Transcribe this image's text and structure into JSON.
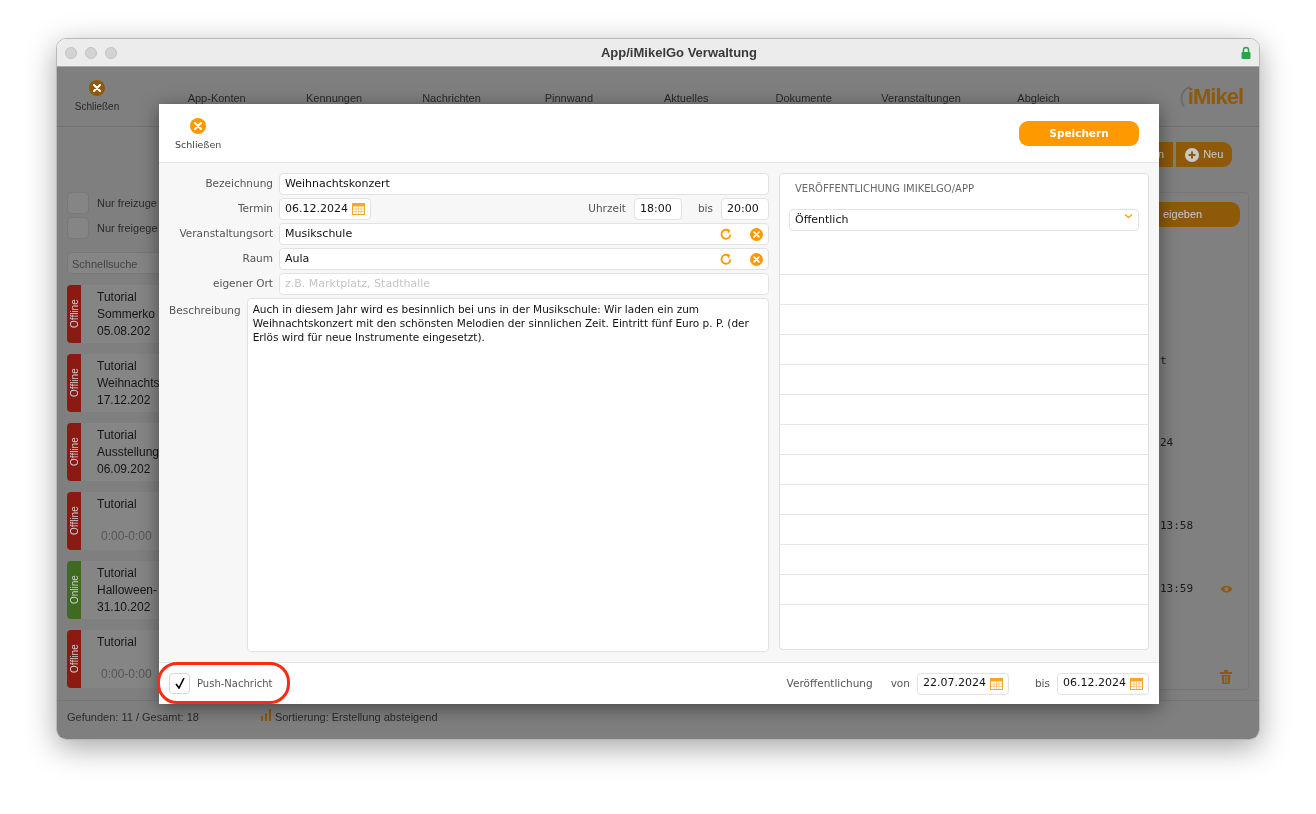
{
  "window": {
    "title": "App/iMikelGo Verwaltung"
  },
  "toolbar": {
    "close_label": "Schließen",
    "nav": [
      {
        "label": "App-Konten"
      },
      {
        "label": "Kennungen"
      },
      {
        "label": "Nachrichten"
      },
      {
        "label": "Pinnwand"
      },
      {
        "label": "Aktuelles"
      },
      {
        "label": "Dokumente"
      },
      {
        "label": "Veranstaltungen"
      },
      {
        "label": "Abgleich"
      }
    ],
    "logo": "iMikel"
  },
  "sidebar": {
    "filters": [
      {
        "label": "Nur freizuge",
        "checked": false
      },
      {
        "label": "Nur freigege",
        "checked": false
      }
    ],
    "search": {
      "placeholder": "Schnellsuche"
    },
    "items": [
      {
        "status": "Offline",
        "online": false,
        "title": "Tutorial",
        "subtitle": "Sommerko",
        "date": "05.08.202"
      },
      {
        "status": "Offline",
        "online": false,
        "title": "Tutorial",
        "subtitle": "Weihnachts",
        "date": "17.12.202"
      },
      {
        "status": "Offline",
        "online": false,
        "title": "Tutorial",
        "subtitle": "Ausstellung",
        "date": "06.09.202"
      },
      {
        "status": "Offline",
        "online": false,
        "title": "Tutorial",
        "time": "0:00-0:00"
      },
      {
        "status": "Online",
        "online": true,
        "title": "Tutorial",
        "subtitle": "Halloween-",
        "date": "31.10.202"
      },
      {
        "status": "Offline",
        "online": false,
        "title": "Tutorial",
        "time": "0:00-0:00"
      }
    ]
  },
  "right_panel": {
    "buttons": [
      {
        "label": "n",
        "kind": "plain"
      },
      {
        "label": "Neu",
        "kind": "add"
      }
    ],
    "release_button": "eigeben",
    "details": [
      {
        "text": "t"
      },
      {
        "text": "24"
      },
      {
        "text": "13:58"
      },
      {
        "text": "13:59",
        "visible_icon": true
      }
    ]
  },
  "status_bar": {
    "found": "Gefunden: 11 / Gesamt: 18",
    "sorting": "Sortierung: Erstellung absteigend"
  },
  "dialog": {
    "close_label": "Schließen",
    "save_label": "Speichern",
    "fields": [
      {
        "kind": "text",
        "label": "Bezeichnung",
        "value": "Weihnachtskonzert"
      },
      {
        "kind": "datetime",
        "label": "Termin",
        "value": "06.12.2024",
        "time_label": "Uhrzeit",
        "start": "18:00",
        "end_label": "bis",
        "end": "20:00"
      },
      {
        "kind": "place",
        "label": "Veranstaltungsort",
        "value": "Musikschule"
      },
      {
        "kind": "place",
        "label": "Raum",
        "value": "Aula"
      },
      {
        "kind": "text",
        "label": "eigener Ort",
        "placeholder": "z.B. Marktplatz, Stadthalle"
      }
    ],
    "description": {
      "label": "Beschreibung",
      "value": "Auch in diesem Jahr wird es besinnlich bei uns in der Musikschule: Wir laden ein zum Weihnachtskonzert mit den schönsten Melodien der sinnlichen Zeit. Eintritt fünf Euro p. P. (der Erlös wird für neue Instrumente eingesetzt)."
    },
    "publication": {
      "heading": "VERÖFFENTLICHUNG IMIKELGO/APP",
      "visibility": "Öffentlich"
    },
    "footer": {
      "push": {
        "label": "Push-Nachricht",
        "checked": true,
        "highlighted": true
      },
      "publication_label": "Veröffentlichung",
      "from_label": "von",
      "from": "22.07.2024",
      "to_label": "bis",
      "to": "06.12.2024"
    }
  }
}
